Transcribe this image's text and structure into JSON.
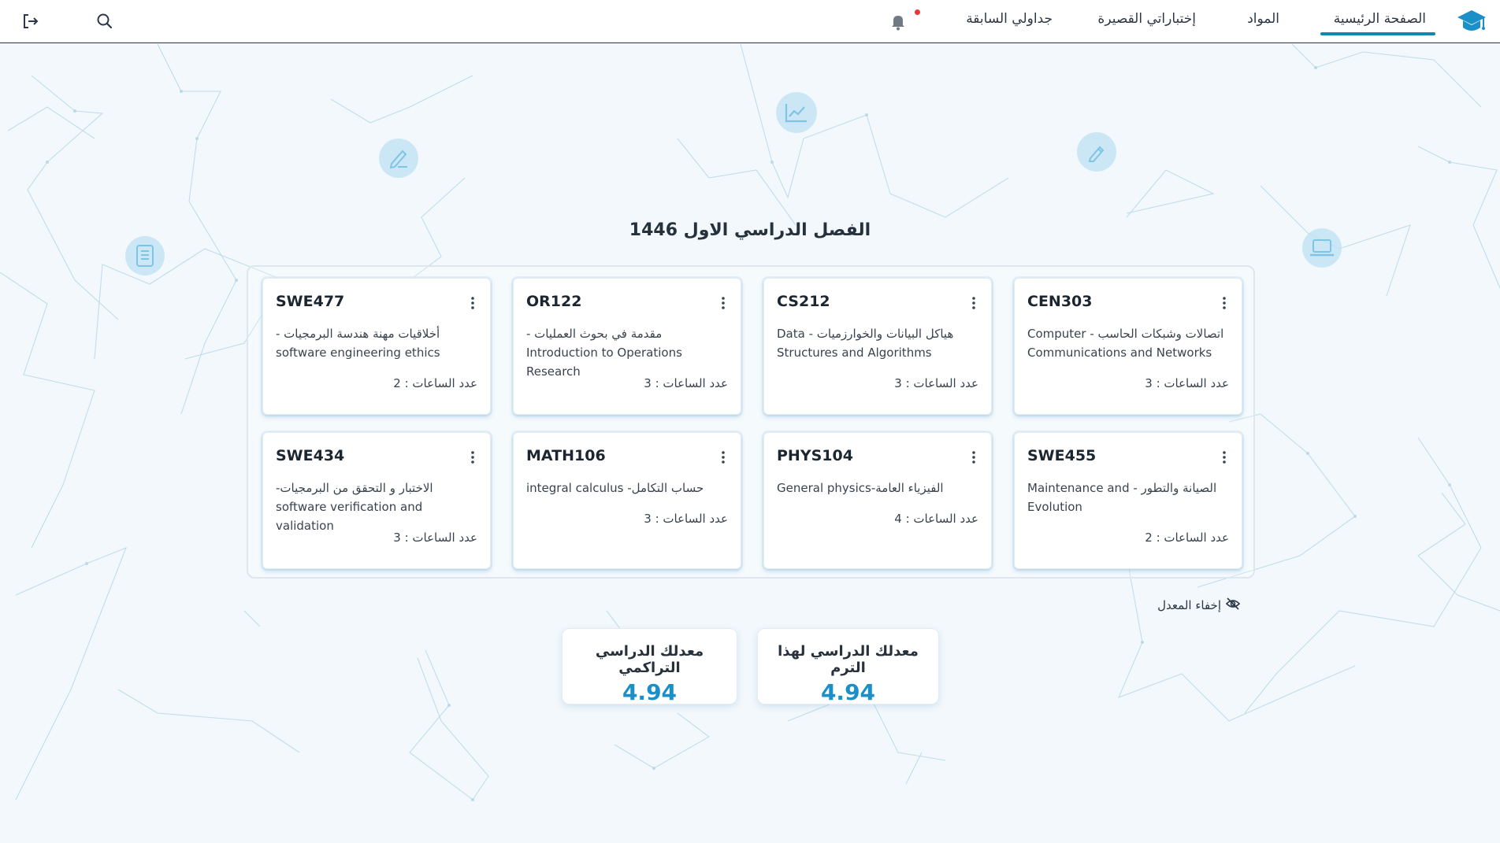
{
  "nav": {
    "items": [
      {
        "label": "الصفحة الرئيسية",
        "active": true
      },
      {
        "label": "المواد",
        "active": false
      },
      {
        "label": "إختباراتي القصيرة",
        "active": false
      },
      {
        "label": "جداولي السابقة",
        "active": false
      }
    ],
    "icons": [
      "graduation-cap-icon",
      "bell-icon",
      "search-icon",
      "logout-icon"
    ],
    "notification_dot_color": "#e53935",
    "accent_color": "#1187b8"
  },
  "semester": {
    "title": "الفصل الدراسي الاول 1446"
  },
  "courses": [
    {
      "code": "CEN303",
      "name": "اتصالات وشبكات الحاسب - Computer Communications and Networks",
      "hours": "عدد الساعات : 3"
    },
    {
      "code": "CS212",
      "name": "هياكل البيانات والخوارزميات - Data Structures and Algorithms",
      "hours": "عدد الساعات : 3"
    },
    {
      "code": "OR122",
      "name": "مقدمة في بحوث العمليات - Introduction to Operations Research",
      "hours": "عدد الساعات : 3"
    },
    {
      "code": "SWE477",
      "name": "أخلاقيات مهنة هندسة البرمجيات - software engineering ethics",
      "hours": "عدد الساعات : 2"
    },
    {
      "code": "SWE455",
      "name": "الصيانة والتطور - Maintenance and Evolution",
      "hours": "عدد الساعات : 2"
    },
    {
      "code": "PHYS104",
      "name": "الفيزياء العامة-General physics",
      "hours": "عدد الساعات : 4"
    },
    {
      "code": "MATH106",
      "name": "حساب التكامل- integral calculus",
      "hours": "عدد الساعات : 3"
    },
    {
      "code": "SWE434",
      "name": "الاختبار و التحقق من البرمجيات- software verification and validation",
      "hours": "عدد الساعات : 3"
    }
  ],
  "gpa": {
    "toggle_label": "إخفاء المعدل",
    "term_label": "معدلك الدراسي لهذا الترم",
    "term_value": "4.94",
    "cumulative_label": "معدلك الدراسي التراكمي",
    "cumulative_value": "4.94",
    "value_color": "#1a8fc8"
  }
}
